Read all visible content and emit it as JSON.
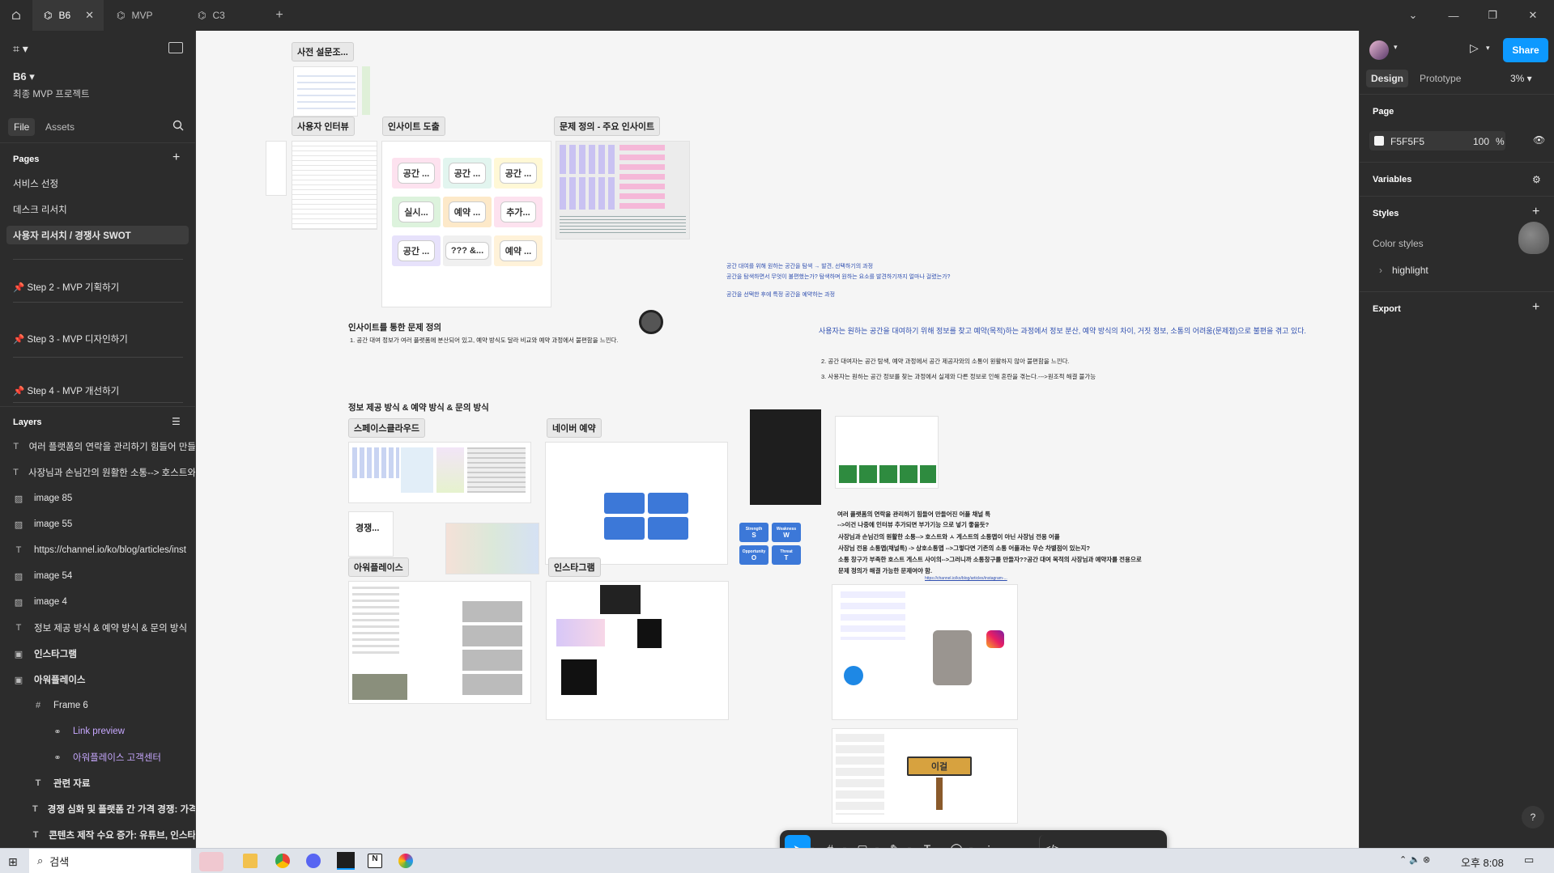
{
  "tabs": {
    "home_icon": "home-icon",
    "items": [
      {
        "label": "B6",
        "active": true
      },
      {
        "label": "MVP",
        "active": false
      },
      {
        "label": "C3",
        "active": false
      }
    ],
    "add": "+"
  },
  "left": {
    "file_name": "B6",
    "project": "최종 MVP 프로젝트",
    "file_tab": "File",
    "assets_tab": "Assets",
    "pages_title": "Pages",
    "pages": [
      "서비스 선정",
      "데스크 리서치",
      "사용자 리서치 / 경쟁사 SWOT",
      "Step 2  - MVP 기획하기",
      "Step 3 - MVP 디자인하기",
      "Step 4 - MVP 개선하기"
    ],
    "layers_title": "Layers",
    "layers": [
      "여러 플랫폼의 연락을 관리하기 힘들어 만들",
      "사장님과 손님간의 원활한 소통--> 호스트와",
      "image 85",
      "image 55",
      "https://channel.io/ko/blog/articles/inst",
      "image 54",
      "image 4",
      "정보 제공 방식 & 예약 방식 & 문의 방식",
      "인스타그램",
      "아워플레이스",
      "Frame 6",
      "Link preview",
      "아워플레이스 고객센터",
      "관련 자료",
      "경쟁 심화 및 플랫폼 간 가격 경쟁: 가격",
      "콘텐츠 제작 수요 증가: 유튜브, 인스타"
    ]
  },
  "right": {
    "share": "Share",
    "design_tab": "Design",
    "prototype_tab": "Prototype",
    "zoom": "3%",
    "page_title": "Page",
    "page_color": "F5F5F5",
    "page_opacity": "100",
    "percent": "%",
    "variables": "Variables",
    "styles": "Styles",
    "color_styles": "Color styles",
    "highlight": "highlight",
    "export": "Export"
  },
  "canvas": {
    "labels": {
      "survey": "사전 설문조...",
      "interview": "사용자 인터뷰",
      "insight": "인사이트 도출",
      "problem": "문제 정의 - 주요 인사이트",
      "spacecloud": "스페이스클라우드",
      "naver": "네이버 예약",
      "competitor": "경쟁...",
      "ourplace": "아워플레이스",
      "instagram": "인스타그램"
    },
    "stickies": [
      "공간 ...",
      "공간 ...",
      "공간 ...",
      "실시...",
      "예약 ...",
      "추가...",
      "공간 ...",
      "??? &...",
      "예약 ..."
    ],
    "problem_heading": "인사이트를 통한 문제 정의",
    "problem_line1": "1. 공간 대여 정보가 여러 플랫폼에 분산되어 있고, 예약 방식도 달라 비교와 예약 과정에서 불편함을 느낀다.",
    "blue_line1": "공간 대여를 위해 원하는 공간을 탐색 → 발견, 선택하기의 과정",
    "blue_line2": "공간을 탐색하면서 무엇이 불편했는가? 탐색하며 원하는 요소를 발견하기까지 얼마나 걸렸는가?",
    "blue_line3": "공간을 선택한 후에 특정 공간을 예약하는 과정",
    "summary": "사용자는 원하는 공간을 대여하기 위해 정보를 찾고 예약(목적)하는 과정에서 정보 분산, 예약 방식의 차이, 거짓 정보, 소통의 어려움(문제점)으로 불편을 겪고 있다.",
    "point2": "2. 공간 대여자는 공간 탐색, 예약 과정에서 공간 제공자와의 소통이 원활하지 않아 불편함을 느낀다.",
    "point3": "3. 사용자는 원하는 공간 정보를 찾는 과정에서 실제와 다른 정보로 인해 혼란을 겪는다.--->원조적 해결 불가능",
    "info_heading": "정보 제공 방식 & 예약 방식 & 문의 방식",
    "memo1": "여러 플랫폼의 연락을 관리하기 힘들어 만들어진 어플 채널 톡",
    "memo2": "-->이건 나중에 인터뷰 추가되면 부가기능 으로 넣기 좋을듯?",
    "memo3": "사장님과 손님간의 원활한 소통--> 호스트와 ㅅ 게스트의 소통앱이 아닌 사장님 전용 어플",
    "memo4": "사장님 전용 소통앱(채널톡) -> 상호소통앱 -->그렇다면 기존의 소통 어플과는 무슨 차별점이 있는지?",
    "memo5": "소통 창구가 부족한 호스트 게스트 사이의-->그러니까 소통창구를 만들자??공간 대여 목적의 사장님과 예약자를 전용으로",
    "memo6": "문제 정의가 해결 가능한 문제여야 함.",
    "link": "https://channel.io/ko/blog/articles/instagram-...",
    "swot": [
      {
        "letter": "S",
        "word": "Strength"
      },
      {
        "letter": "W",
        "word": "Weakness"
      },
      {
        "letter": "O",
        "word": "Opportunity"
      },
      {
        "letter": "T",
        "word": "Threat"
      }
    ],
    "sign_text": "이걸"
  },
  "taskbar": {
    "search": "검색",
    "time": "오후 8:08"
  },
  "colors": {
    "accent": "#0d99ff",
    "panel": "#2c2c2c",
    "canvas": "#f5f5f5"
  }
}
